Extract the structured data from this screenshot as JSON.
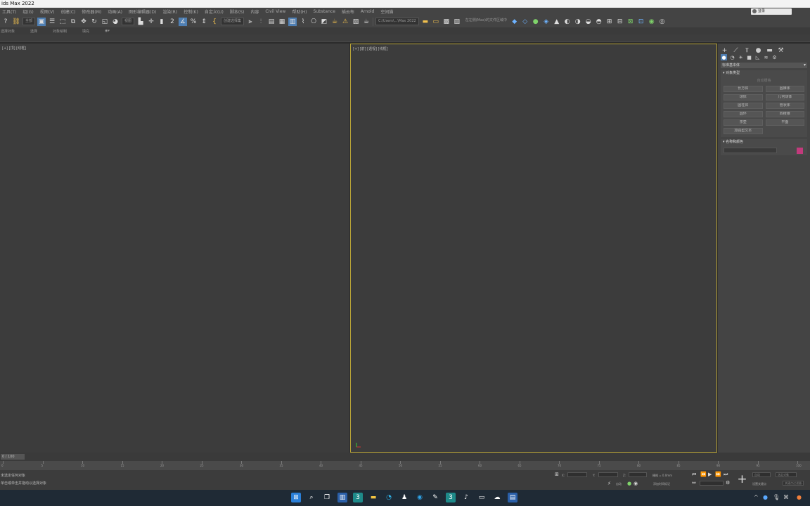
{
  "app": {
    "title": "ids Max 2022"
  },
  "menu": [
    "工具(T)",
    "组(G)",
    "视图(V)",
    "创建(C)",
    "修改器(M)",
    "动画(A)",
    "图形编辑器(D)",
    "渲染(R)",
    "控制(K)",
    "自定义(U)",
    "脚本(S)",
    "内容",
    "Civil View",
    "帮助(H)",
    "Substance",
    "插云布",
    "Arnold",
    "空间猫"
  ],
  "account": {
    "signin": "登录",
    "help": ""
  },
  "toolbar": {
    "undo_label": "全部",
    "selection_filter": "全部",
    "named_selection": "创建选择集",
    "ref_coord": "视图",
    "workspace": "C:\\Users\\...\\Max 2022",
    "status_text": "在左侧(Max)的文件区域中（文件 > 输入 ）"
  },
  "ribbon": {
    "tabs": [
      "选择对象",
      "选择",
      "对象绘制",
      "填充"
    ]
  },
  "viewports": {
    "left_label": "[+] [顶] [线框]",
    "right_label": "[+] [前] [透视] [线框]"
  },
  "command_panel": {
    "category": "标准基本体",
    "object_type_header": "对象类型",
    "autogrid": "自动栅格",
    "buttons": [
      "长方体",
      "圆锥体",
      "球体",
      "几何球体",
      "圆柱体",
      "管状体",
      "圆环",
      "四棱锥",
      "茶壶",
      "平面",
      "加强型文本"
    ],
    "name_color_header": "名称和颜色",
    "object_color": "#c23a7c"
  },
  "timeline": {
    "frame_display": "0 / 100",
    "ticks": [
      0,
      5,
      10,
      15,
      20,
      25,
      30,
      35,
      40,
      45,
      50,
      55,
      60,
      65,
      70,
      75,
      80,
      85,
      90,
      95,
      100
    ]
  },
  "status": {
    "line1": "未选定任何对象",
    "line2": "单击或单击并拖动以选择对象",
    "x_label": "X:",
    "y_label": "Y:",
    "z_label": "Z:",
    "grid_label": "栅格 = 0.0mm",
    "autokey": "自动",
    "setkey": "设置关键点",
    "selected": "选定对象",
    "keyfilter": "关键点过滤器...",
    "time_tag": "添加时间标记"
  }
}
